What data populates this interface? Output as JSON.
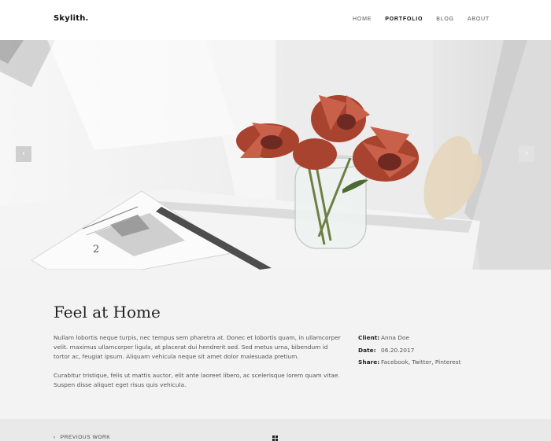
{
  "header": {
    "logo": "Skylith.",
    "nav": [
      {
        "label": "HOME",
        "active": false
      },
      {
        "label": "PORTFOLIO",
        "active": true
      },
      {
        "label": "BLOG",
        "active": false
      },
      {
        "label": "ABOUT",
        "active": false
      }
    ]
  },
  "hero": {
    "prev_icon": "‹",
    "next_icon": "›",
    "newspaper_number": "2"
  },
  "project": {
    "title": "Feel at Home",
    "paragraphs": [
      "Nullam lobortis neque turpis, nec tempus sem pharetra at. Donec et lobortis quam, in ullamcorper velit. maximus ullamcorper ligula, at placerat dui hendrerit sed. Sed metus urna, bibendum id tortor ac, feugiat ipsum. Aliquam vehicula neque sit amet dolor malesuada pretium.",
      "Curabitur tristique, felis ut mattis auctor, elit ante laoreet libero, ac scelerisque lorem quam vitae. Suspen disse aliquet eget risus quis vehicula."
    ],
    "meta": [
      {
        "label": "Client:",
        "value": "Anna Doe"
      },
      {
        "label": "Date:",
        "value": "06.20.2017"
      },
      {
        "label": "Share:",
        "value": "Facebook, Twitter, Pinterest"
      }
    ]
  },
  "footer_nav": {
    "prev_icon": "‹",
    "prev_label": "PREVIOUS WORK"
  },
  "colors": {
    "content_bg": "#f3f3f3",
    "petal": "#b4503c",
    "text_dark": "#222222"
  }
}
